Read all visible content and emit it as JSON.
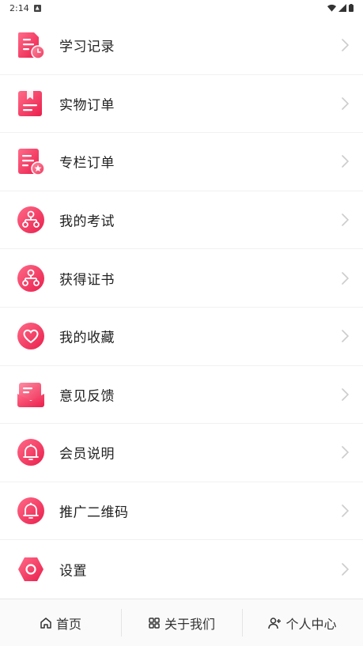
{
  "status_bar": {
    "time": "2:14"
  },
  "menu": [
    {
      "label": "学习记录",
      "icon": "study-record-icon"
    },
    {
      "label": "实物订单",
      "icon": "physical-order-icon"
    },
    {
      "label": "专栏订单",
      "icon": "column-order-icon"
    },
    {
      "label": "我的考试",
      "icon": "exam-icon"
    },
    {
      "label": "获得证书",
      "icon": "certificate-icon"
    },
    {
      "label": "我的收藏",
      "icon": "heart-icon"
    },
    {
      "label": "意见反馈",
      "icon": "feedback-icon"
    },
    {
      "label": "会员说明",
      "icon": "bell-icon"
    },
    {
      "label": "推广二维码",
      "icon": "bell-icon"
    },
    {
      "label": "设置",
      "icon": "settings-icon"
    }
  ],
  "tabs": [
    {
      "label": "首页",
      "icon": "home-icon"
    },
    {
      "label": "关于我们",
      "icon": "grid-icon"
    },
    {
      "label": "个人中心",
      "icon": "user-add-icon"
    }
  ],
  "colors": {
    "accent": "#ef2e55",
    "accent_light": "#ff7a95",
    "chevron": "#cccccc"
  }
}
